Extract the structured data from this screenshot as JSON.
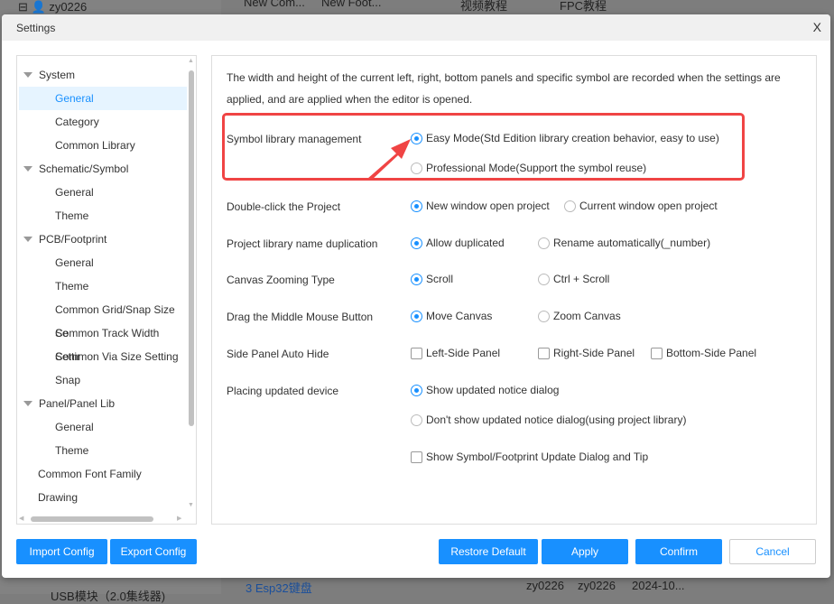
{
  "background": {
    "user": "zy0226",
    "tabs": [
      "New Com...",
      "New Foot..."
    ],
    "links": [
      "视频教程",
      "FPC教程"
    ],
    "row": {
      "name": "3 Esp32键盘",
      "creator": "zy0226",
      "modifier": "zy0226",
      "date": "2024-10..."
    },
    "folder": "USB模块（2.0集线器)"
  },
  "dialog": {
    "title": "Settings",
    "close": "X"
  },
  "tree": [
    {
      "label": "System",
      "level": 0,
      "expanded": true
    },
    {
      "label": "General",
      "level": 1,
      "selected": true
    },
    {
      "label": "Category",
      "level": 1
    },
    {
      "label": "Common Library",
      "level": 1
    },
    {
      "label": "Schematic/Symbol",
      "level": 0,
      "expanded": true
    },
    {
      "label": "General",
      "level": 1
    },
    {
      "label": "Theme",
      "level": 1
    },
    {
      "label": "PCB/Footprint",
      "level": 0,
      "expanded": true
    },
    {
      "label": "General",
      "level": 1
    },
    {
      "label": "Theme",
      "level": 1
    },
    {
      "label": "Common Grid/Snap Size Se",
      "level": 1
    },
    {
      "label": "Common Track Width Settir",
      "level": 1
    },
    {
      "label": "Common Via Size Setting",
      "level": 1
    },
    {
      "label": "Snap",
      "level": 1
    },
    {
      "label": "Panel/Panel Lib",
      "level": 0,
      "expanded": true
    },
    {
      "label": "General",
      "level": 1
    },
    {
      "label": "Theme",
      "level": 1
    },
    {
      "label": "Common Font Family",
      "level": 0,
      "leaf": true
    },
    {
      "label": "Drawing",
      "level": 0,
      "leaf": true
    }
  ],
  "main": {
    "description": "The width and height of the current left, right, bottom panels and specific symbol are recorded when the settings are applied, and are applied when the editor is opened.",
    "settings": [
      {
        "label": "Symbol library management",
        "type": "radio",
        "options": [
          {
            "label": "Easy Mode(Std Edition library creation behavior, easy to use)",
            "checked": true
          },
          {
            "label": "Professional Mode(Support the symbol reuse)",
            "checked": false
          }
        ]
      },
      {
        "label": "Double-click the Project",
        "type": "radio",
        "options": [
          {
            "label": "New window open project",
            "checked": true
          },
          {
            "label": "Current window open project",
            "checked": false
          }
        ]
      },
      {
        "label": "Project library name duplication",
        "type": "radio",
        "options": [
          {
            "label": "Allow duplicated",
            "checked": true
          },
          {
            "label": "Rename automatically(_number)",
            "checked": false
          }
        ]
      },
      {
        "label": "Canvas Zooming Type",
        "type": "radio",
        "options": [
          {
            "label": "Scroll",
            "checked": true
          },
          {
            "label": "Ctrl + Scroll",
            "checked": false
          }
        ]
      },
      {
        "label": "Drag the Middle Mouse Button",
        "type": "radio",
        "options": [
          {
            "label": "Move Canvas",
            "checked": true
          },
          {
            "label": "Zoom Canvas",
            "checked": false
          }
        ]
      },
      {
        "label": "Side Panel Auto Hide",
        "type": "checkbox",
        "options": [
          {
            "label": "Left-Side Panel",
            "checked": false
          },
          {
            "label": "Right-Side Panel",
            "checked": false
          },
          {
            "label": "Bottom-Side Panel",
            "checked": false
          }
        ]
      },
      {
        "label": "Placing updated device",
        "type": "mixed",
        "options": [
          {
            "label": "Show updated notice dialog",
            "checked": true
          },
          {
            "label": "Don't show updated notice dialog(using project library)",
            "checked": false
          },
          {
            "label": "Show Symbol/Footprint Update Dialog and Tip",
            "checked": false
          }
        ]
      }
    ],
    "highlight_color": "#f04444"
  },
  "buttons": {
    "import": "Import Config",
    "export": "Export Config",
    "restore": "Restore Default",
    "apply": "Apply",
    "confirm": "Confirm",
    "cancel": "Cancel"
  },
  "colors": {
    "accent": "#1890ff",
    "selected_bg": "#e6f4ff"
  }
}
